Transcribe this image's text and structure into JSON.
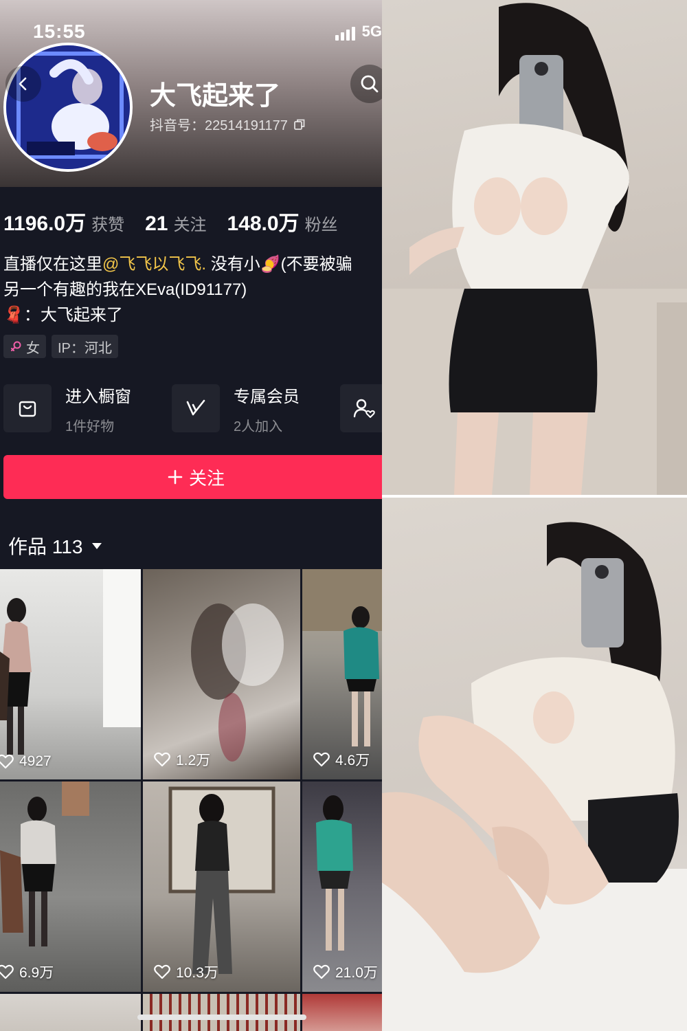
{
  "status_bar": {
    "time": "15:55",
    "network": "5G"
  },
  "profile": {
    "nickname": "大飞起来了",
    "douyin_id": "抖音号：22514191177",
    "stats": [
      {
        "value": "1196.0万",
        "label": "获赞"
      },
      {
        "value": "21",
        "label": "关注"
      },
      {
        "value": "148.0万",
        "label": "粉丝"
      }
    ],
    "bio": {
      "line1_prefix": "直播仅在这里",
      "line1_mention": "@飞飞以飞飞.",
      "line1_suffix": " 没有小🍠(不要被骗",
      "line2": "另一个有趣的我在XEva(ID91177)",
      "line3_icon": "🧣",
      "line3": "：大飞起来了"
    },
    "tags": {
      "gender": "女",
      "ip": "IP：河北"
    }
  },
  "entries": [
    {
      "title": "进入橱窗",
      "subtitle": "1件好物",
      "icon": "bag-icon"
    },
    {
      "title": "专属会员",
      "subtitle": "2人加入",
      "icon": "vip-icon"
    },
    {
      "title": "",
      "subtitle": "",
      "icon": "friend-icon"
    }
  ],
  "follow_button": {
    "label": "关注"
  },
  "works": {
    "label": "作品 113",
    "items": [
      {
        "likes": "4927"
      },
      {
        "likes": "1.2万"
      },
      {
        "likes": "4.6万"
      },
      {
        "likes": "6.9万"
      },
      {
        "likes": "10.3万"
      },
      {
        "likes": "21.0万"
      }
    ]
  },
  "colors": {
    "accent": "#fe2c55",
    "background": "#161823",
    "mention": "#f3c64a"
  }
}
